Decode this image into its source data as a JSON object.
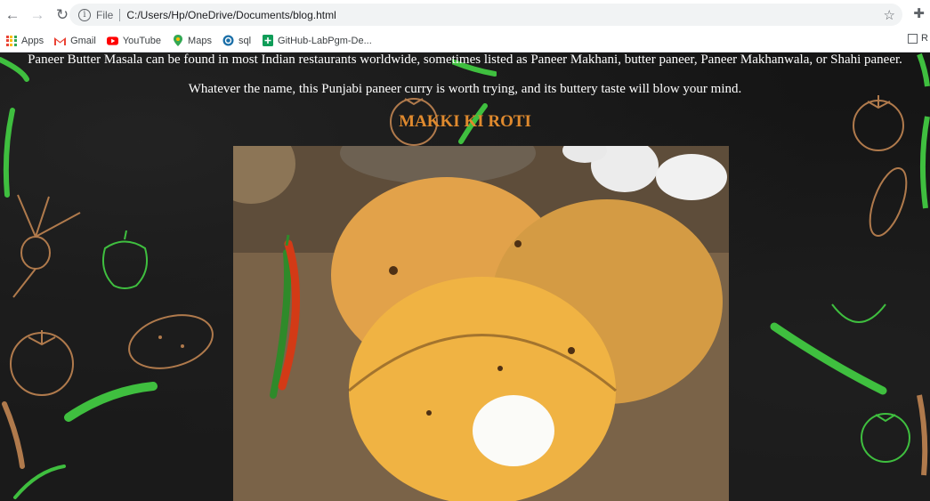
{
  "browser": {
    "url_scheme_label": "File",
    "url": "C:/Users/Hp/OneDrive/Documents/blog.html",
    "bookmarks": [
      {
        "label": "Apps",
        "icon": "apps-grid-icon"
      },
      {
        "label": "Gmail",
        "icon": "gmail-icon"
      },
      {
        "label": "YouTube",
        "icon": "youtube-icon"
      },
      {
        "label": "Maps",
        "icon": "maps-pin-icon"
      },
      {
        "label": "sql",
        "icon": "sql-site-icon"
      },
      {
        "label": "GitHub-LabPgm-De...",
        "icon": "sheets-plus-icon"
      }
    ],
    "reading_list_label": "R"
  },
  "page": {
    "para1": "Paneer Butter Masala can be found in most Indian restaurants worldwide, sometimes listed as Paneer Makhani, butter paneer, Paneer Makhanwala, or Shahi paneer.",
    "para2": "Whatever the name, this Punjabi paneer curry is worth trying, and its buttery taste will blow your mind.",
    "heading": "MAKKI KI ROTI"
  },
  "colors": {
    "heading": "#e08a2e",
    "background": "#151515",
    "sketch_orange": "#b07a4c",
    "sketch_green": "#3fbf3f"
  }
}
